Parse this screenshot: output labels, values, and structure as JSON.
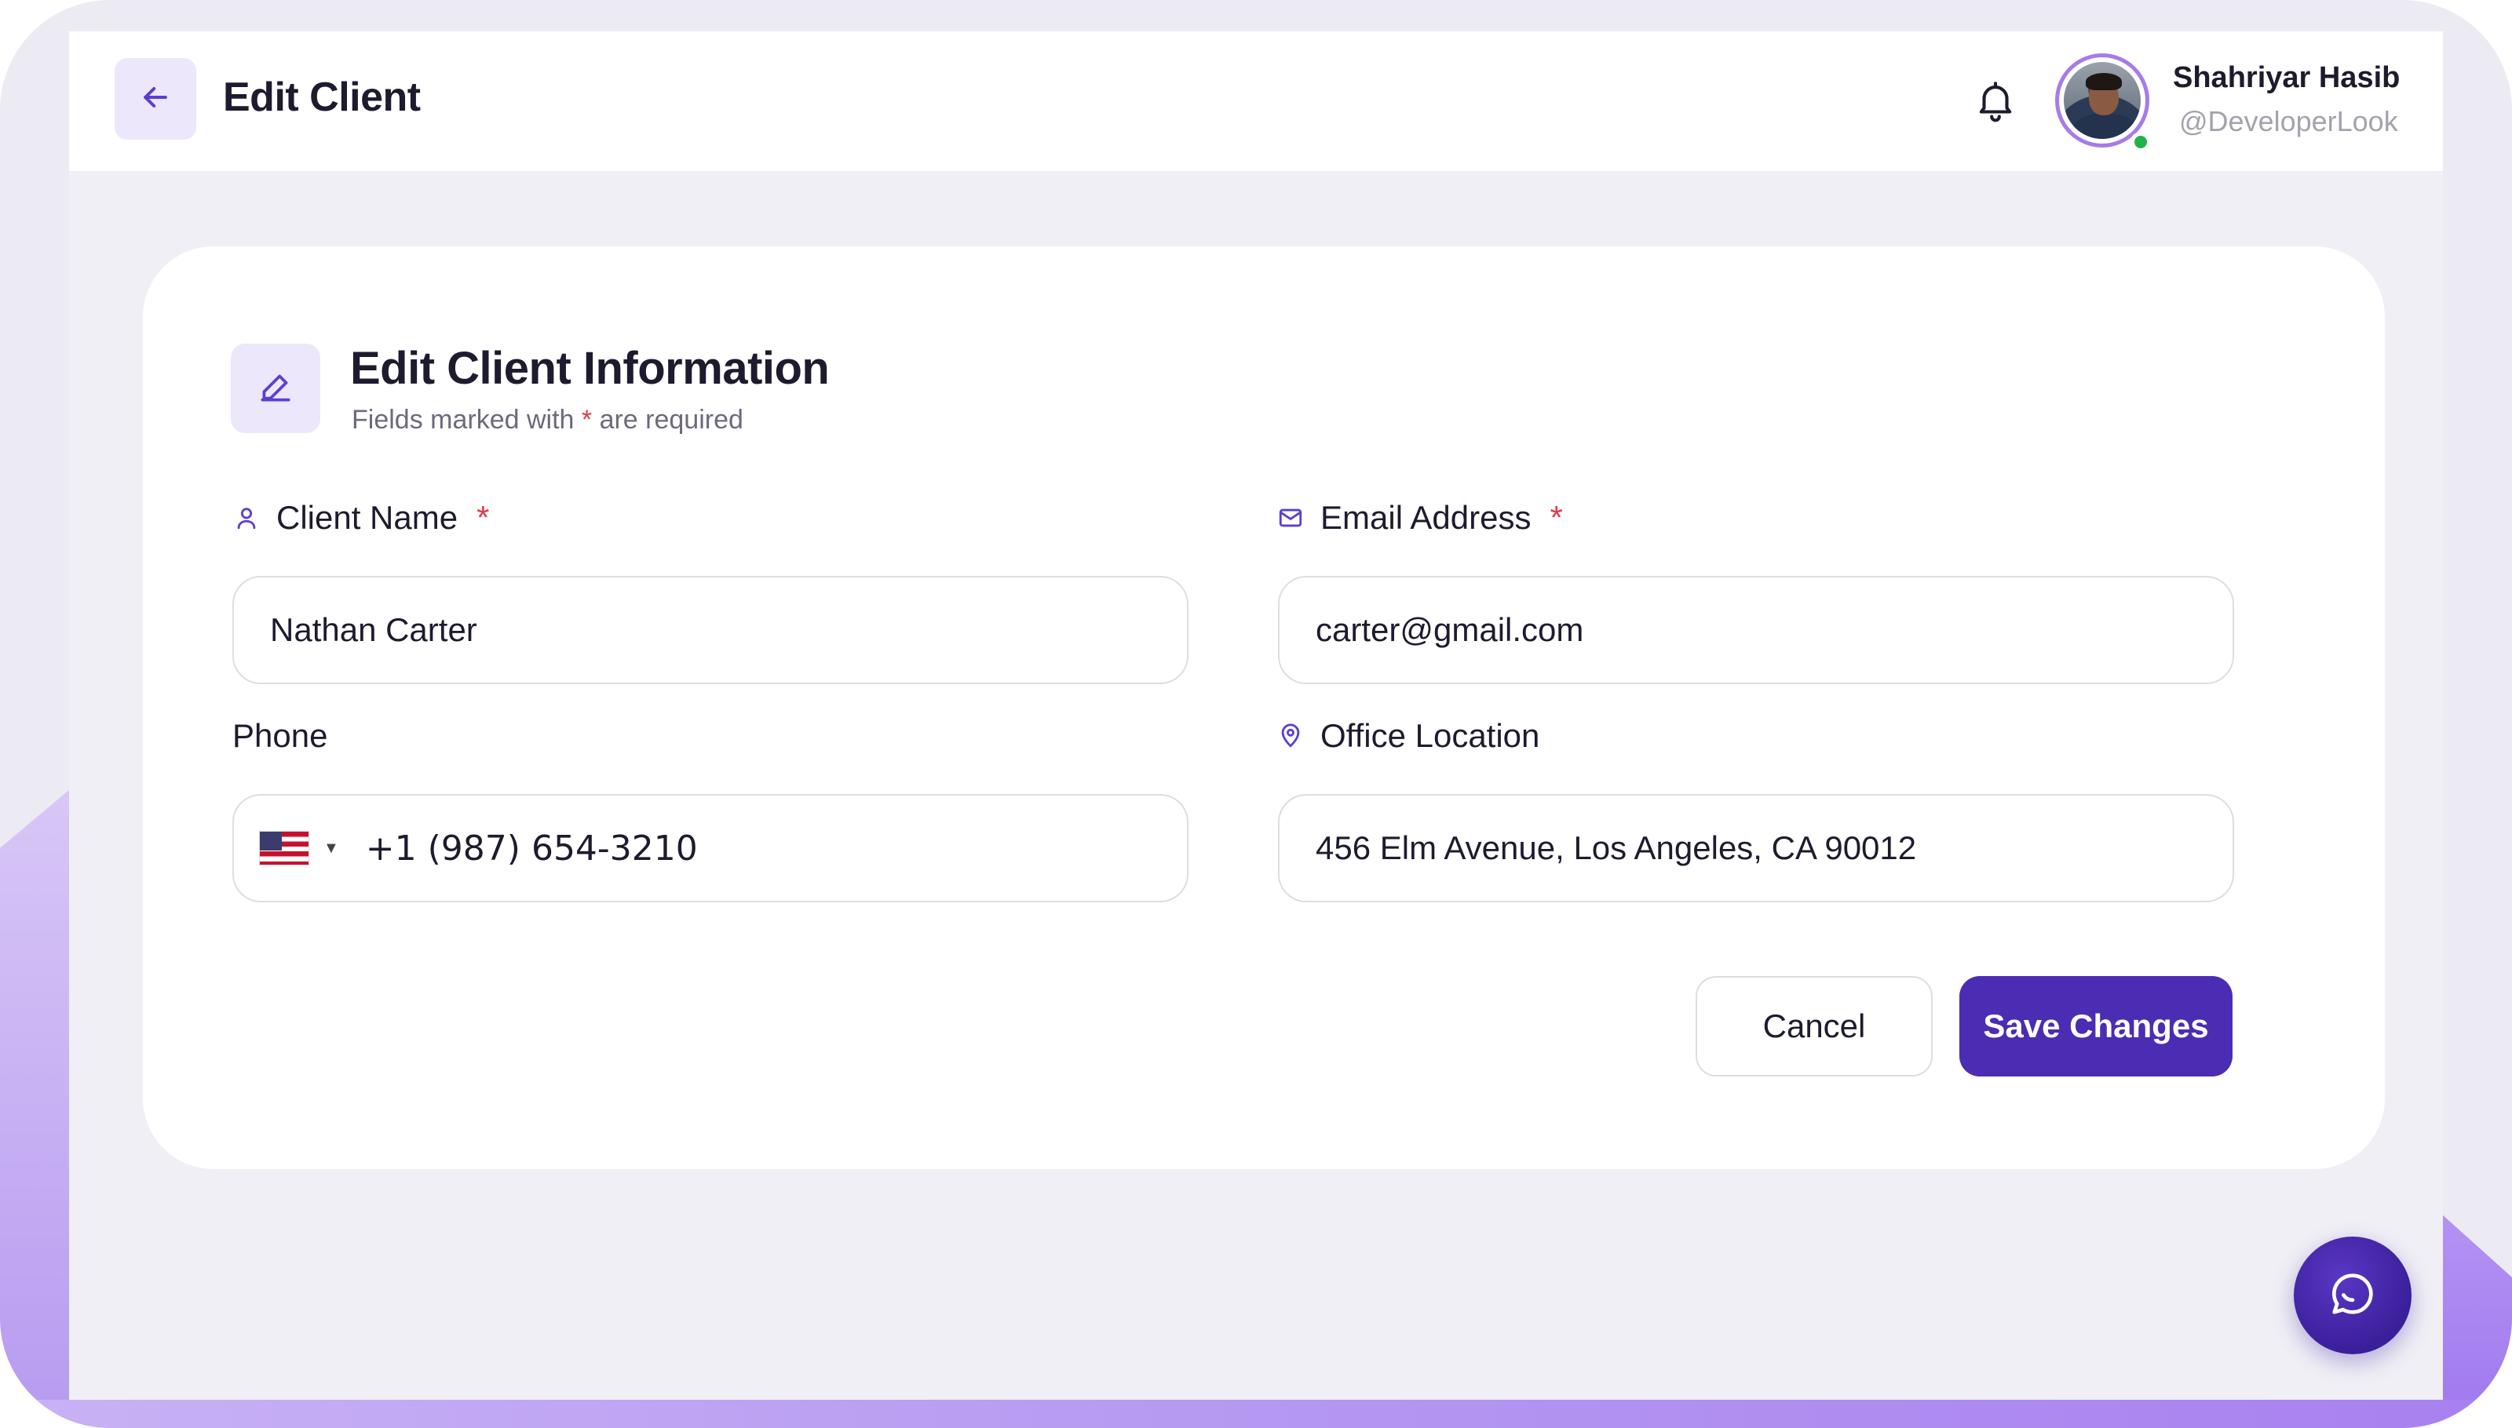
{
  "header": {
    "title": "Edit Client",
    "back_icon": "arrow-left-icon",
    "notification_icon": "bell-icon",
    "user": {
      "name": "Shahriyar Hasib",
      "handle": "@DeveloperLook",
      "status": "online"
    }
  },
  "form": {
    "title": "Edit Client Information",
    "subtitle_prefix": "Fields marked with",
    "subtitle_star": "*",
    "subtitle_suffix": "are required",
    "fields": {
      "client_name": {
        "label": "Client Name",
        "required_mark": "*",
        "value": "Nathan Carter",
        "icon": "user-icon"
      },
      "email": {
        "label": "Email Address",
        "required_mark": "*",
        "value": "carter@gmail.com",
        "icon": "mail-icon"
      },
      "phone": {
        "label": "Phone",
        "country_flag": "us-flag-icon",
        "value": "+1 (987) 654-3210"
      },
      "office_location": {
        "label": "Office Location",
        "value": "456 Elm Avenue, Los Angeles, CA 90012",
        "icon": "map-pin-icon"
      }
    },
    "buttons": {
      "cancel": "Cancel",
      "save": "Save Changes"
    }
  },
  "fab": {
    "icon": "chat-bubble-icon"
  },
  "colors": {
    "accent": "#4b2db3",
    "accent_light": "#ece7fb",
    "required": "#e0394a",
    "online": "#22b24c",
    "background": "#f0eff5"
  }
}
